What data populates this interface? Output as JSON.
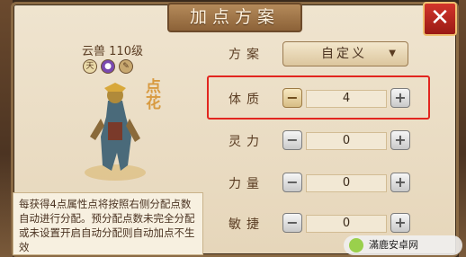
{
  "dialog": {
    "title": "加点方案",
    "close_glyph": "✕"
  },
  "pet": {
    "name": "云兽 110级",
    "traits": [
      {
        "icon": "sky-badge-icon",
        "glyph": "天"
      },
      {
        "icon": "purple-orb-icon",
        "glyph": "●"
      },
      {
        "icon": "feather-icon",
        "glyph": "✎"
      }
    ],
    "stamp": "点花",
    "description": "每获得4点属性点将按照右侧分配点数自动进行分配。预分配点数未完全分配或未设置开启自动分配则自动加点不生效"
  },
  "scheme": {
    "label": "方案",
    "selected": "自定义"
  },
  "attributes": [
    {
      "label": "体质",
      "value": "4",
      "highlighted": true
    },
    {
      "label": "灵力",
      "value": "0"
    },
    {
      "label": "力量",
      "value": "0"
    },
    {
      "label": "敏捷",
      "value": "0"
    }
  ],
  "watermark": "滿鹿安卓网",
  "colors": {
    "highlight": "#e2261f",
    "close_bg": "#c0281f"
  }
}
